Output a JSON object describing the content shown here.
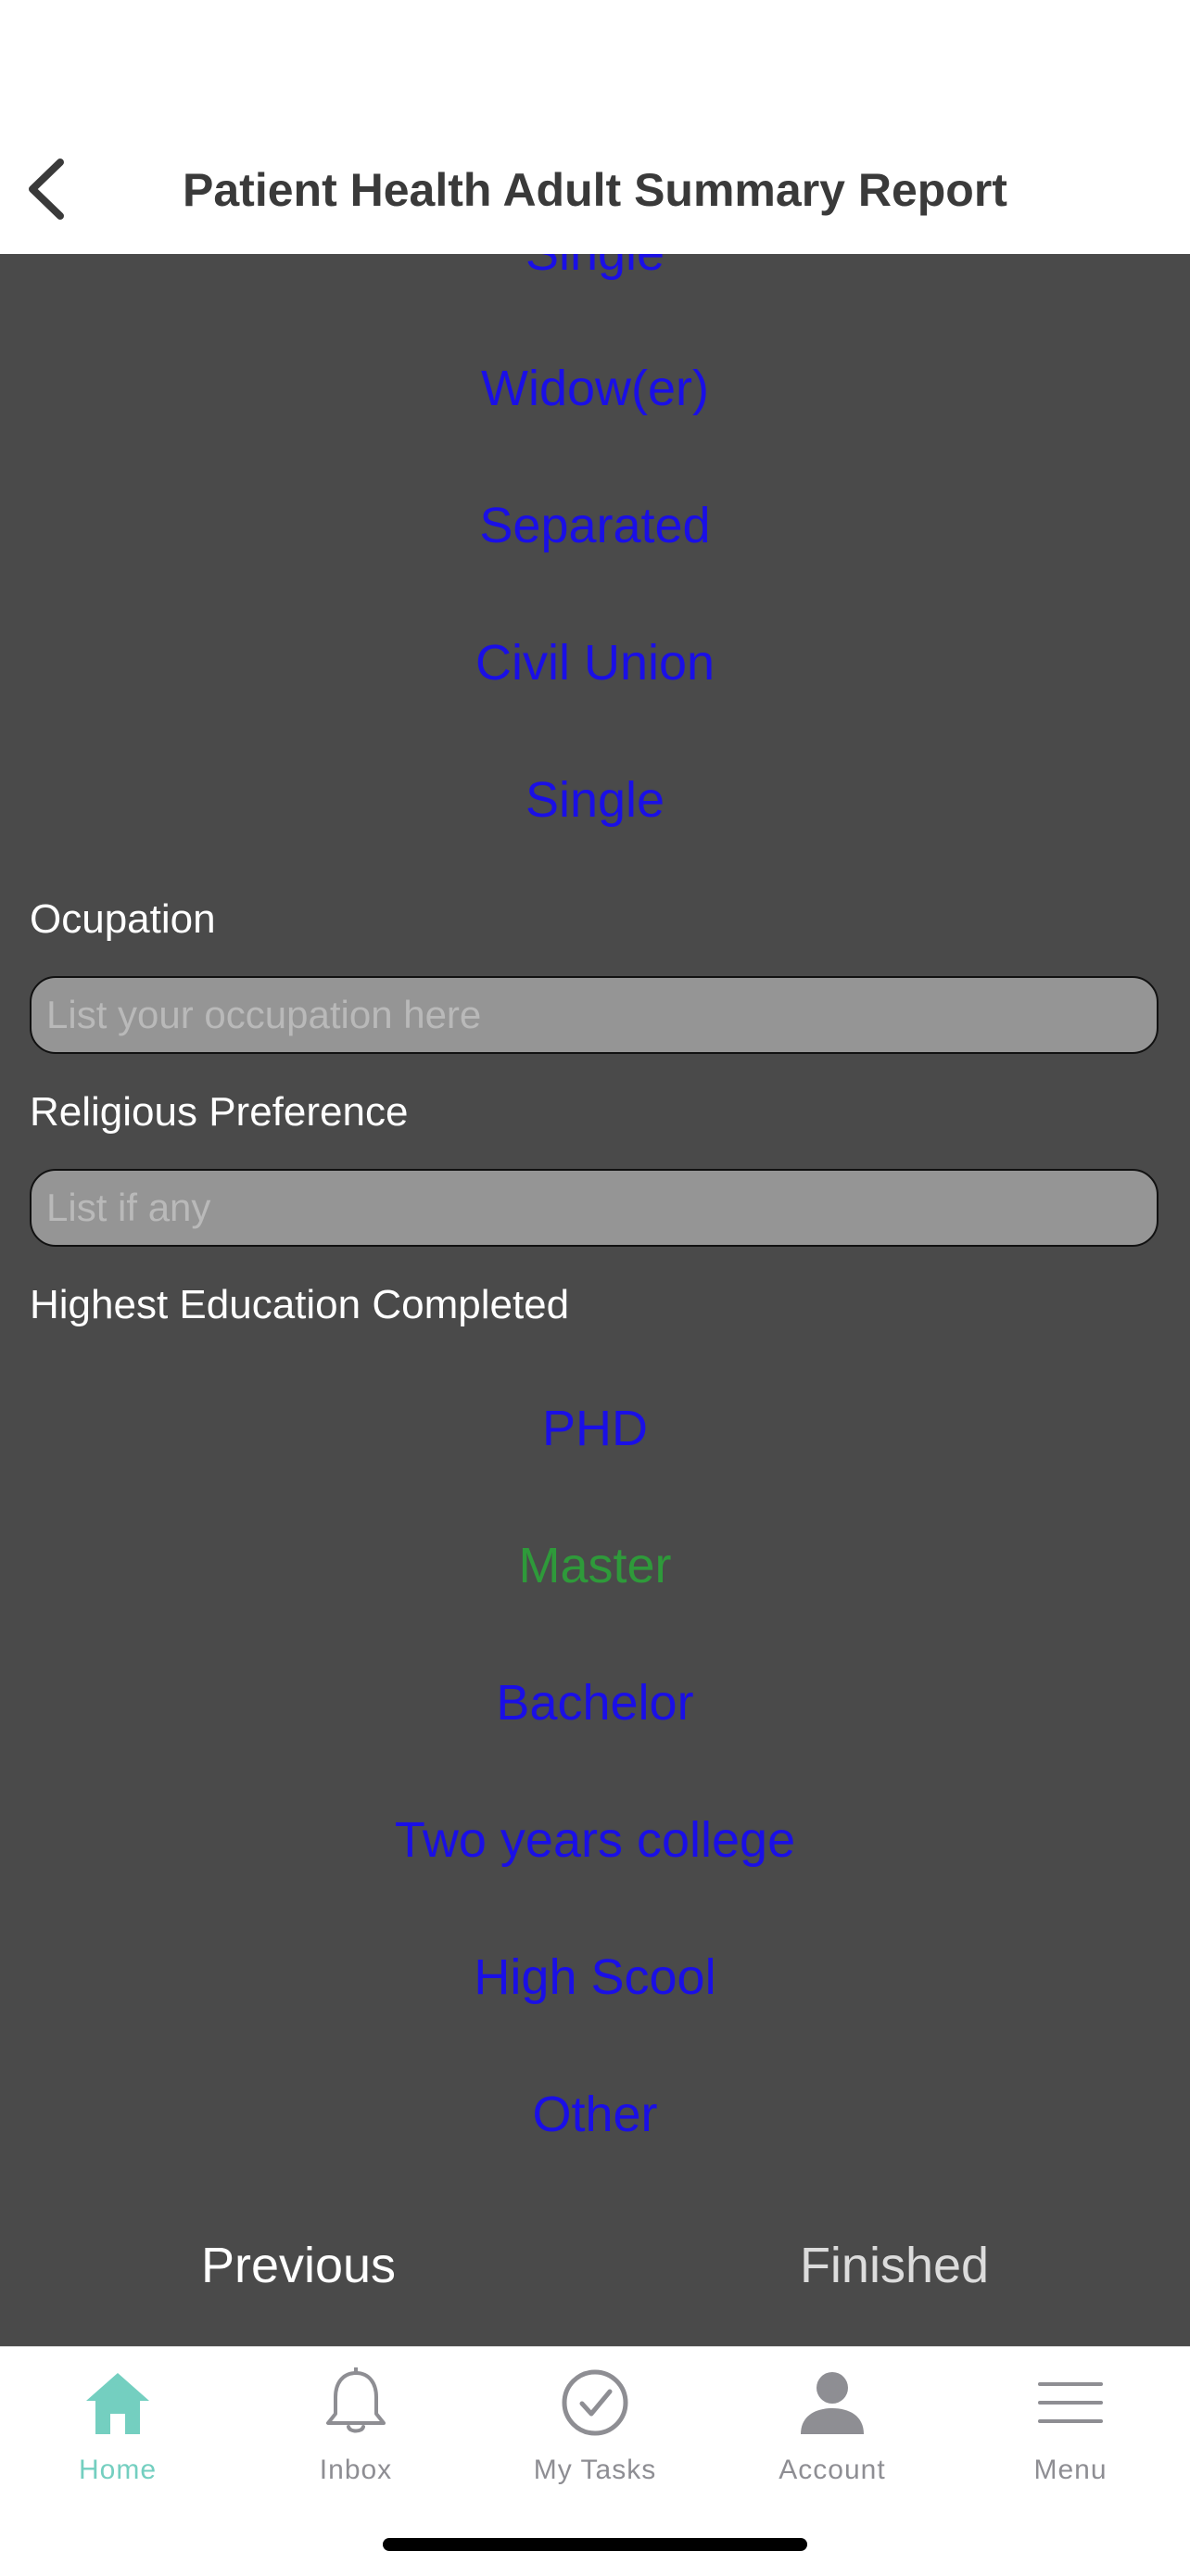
{
  "header": {
    "title": "Patient Health Adult Summary Report"
  },
  "marital_status": {
    "options": [
      "Single",
      "Widow(er)",
      "Separated",
      "Civil Union",
      "Single"
    ]
  },
  "occupation": {
    "label": "Ocupation",
    "value": "",
    "placeholder": "List your occupation here"
  },
  "religion": {
    "label": "Religious Preference",
    "value": "",
    "placeholder": "List if any"
  },
  "education": {
    "label": "Highest Education Completed",
    "options": [
      "PHD",
      "Master",
      "Bachelor",
      "Two years college",
      "High Scool",
      "Other"
    ],
    "selected": "Master"
  },
  "navigation": {
    "previous": "Previous",
    "finished": "Finished"
  },
  "tabbar": {
    "items": [
      {
        "label": "Home",
        "icon": "home-icon",
        "active": true
      },
      {
        "label": "Inbox",
        "icon": "bell-icon",
        "active": false
      },
      {
        "label": "My Tasks",
        "icon": "check-circle-icon",
        "active": false
      },
      {
        "label": "Account",
        "icon": "person-icon",
        "active": false
      },
      {
        "label": "Menu",
        "icon": "hamburger-menu-icon",
        "active": false
      }
    ]
  },
  "colors": {
    "option_link": "#1a0fe6",
    "option_selected": "#2e9a3a",
    "content_background": "#4a4a4a",
    "tab_active": "#74cfc0",
    "tab_inactive": "#8e8e93"
  }
}
